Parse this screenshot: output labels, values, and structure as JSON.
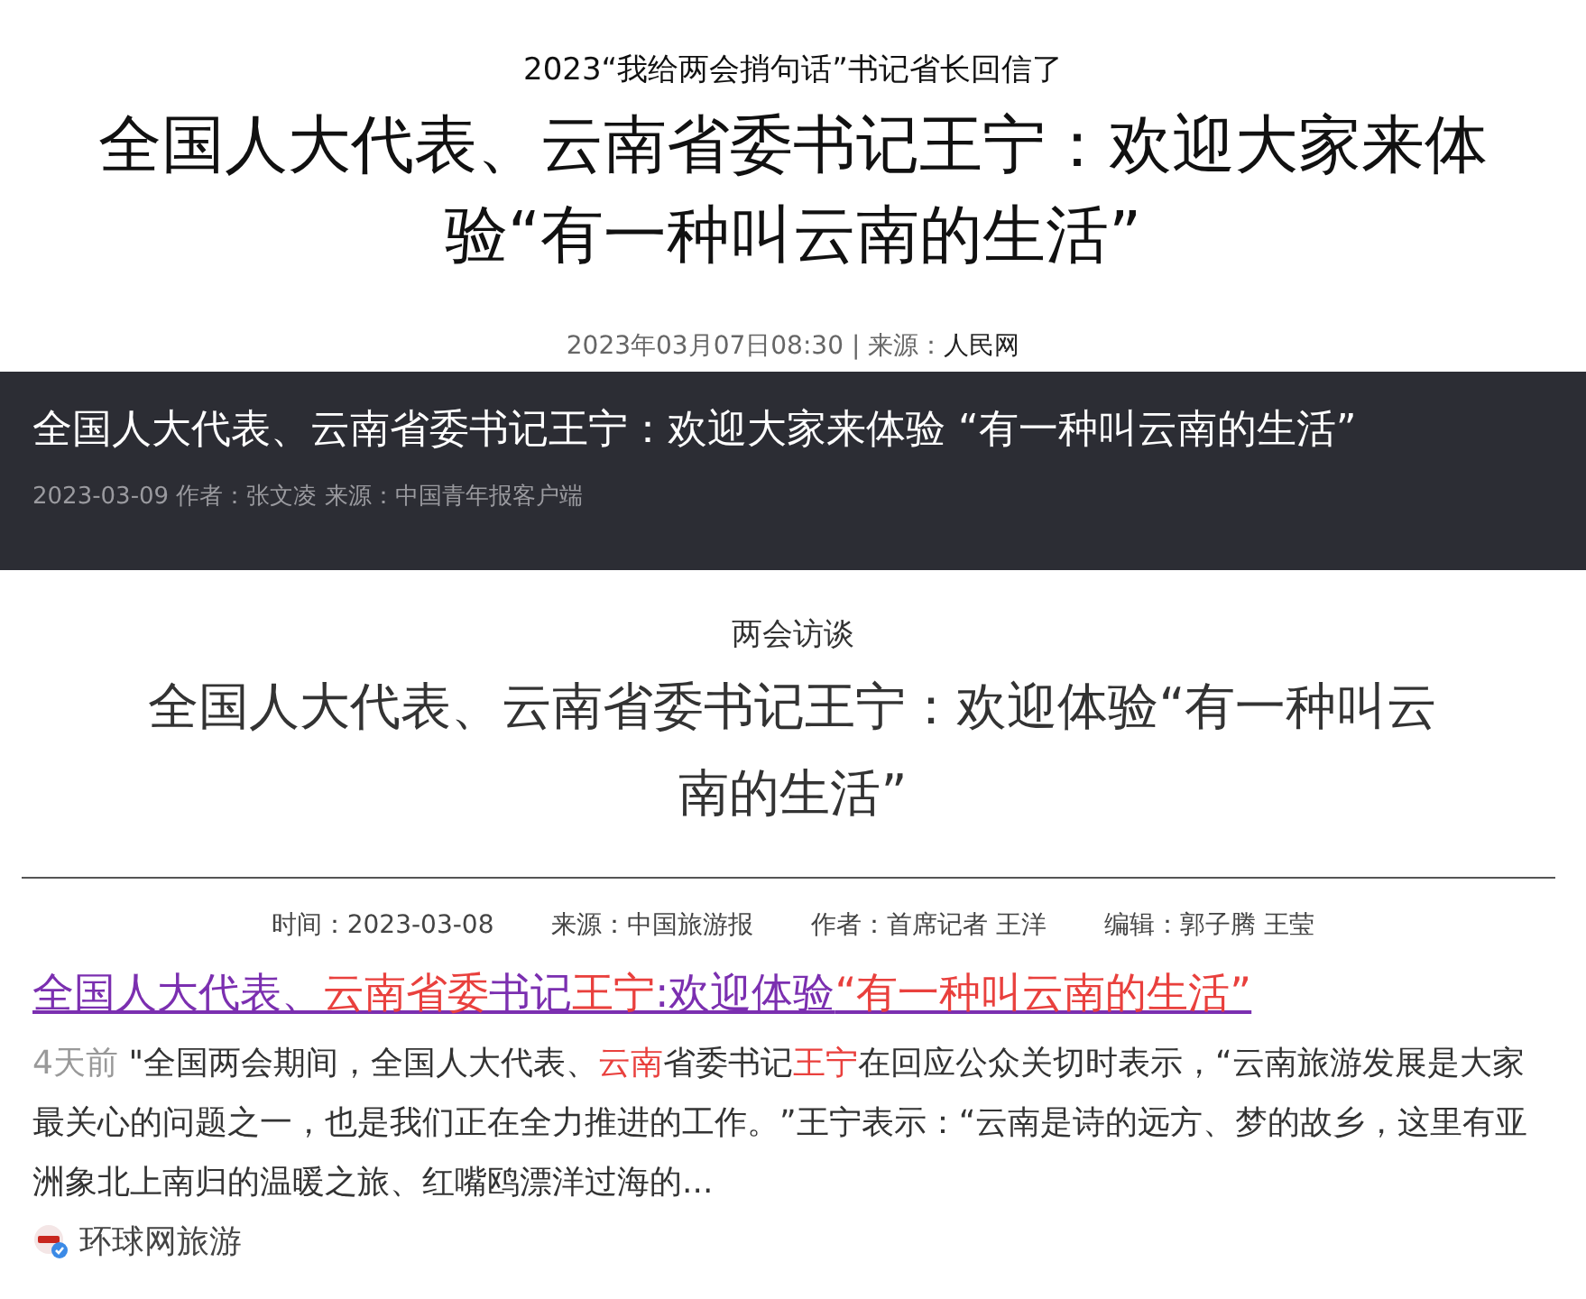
{
  "header_article": {
    "kicker": "2023“我给两会捎句话”书记省长回信了",
    "title": "全国人大代表、云南省委书记王宁：欢迎大家来体验“有一种叫云南的生活”",
    "date": "2023年03月07日08:30",
    "separator": "|",
    "source_label": "来源：",
    "source": "人民网"
  },
  "dark_banner": {
    "title": "全国人大代表、云南省委书记王宁：欢迎大家来体验 “有一种叫云南的生活”",
    "meta": "2023-03-09 作者：张文凌 来源：中国青年报客户端"
  },
  "interview": {
    "category": "两会访谈",
    "title": "全国人大代表、云南省委书记王宁：欢迎体验“有一种叫云南的生活”",
    "meta": [
      "时间：2023-03-08",
      "来源：中国旅游报",
      "作者：首席记者 王洋",
      "编辑：郭子腾 王莹"
    ]
  },
  "search_result": {
    "title_parts": [
      {
        "text": "全国人大代表、",
        "highlight": false
      },
      {
        "text": "云南省委",
        "highlight": true
      },
      {
        "text": "书记",
        "highlight": false
      },
      {
        "text": "王宁",
        "highlight": true
      },
      {
        "text": ":欢迎体验",
        "highlight": false
      },
      {
        "text": "“有一种叫云南的生活”",
        "highlight": true
      }
    ],
    "age": "4天前",
    "snippet_parts": [
      {
        "text": "\"全国两会期间，全国人大代表、",
        "highlight": false
      },
      {
        "text": "云南",
        "highlight": true
      },
      {
        "text": "省委书记",
        "highlight": false
      },
      {
        "text": "王宁",
        "highlight": true
      },
      {
        "text": "在回应公众关切时表示，“云南旅游发展是大家最关心的问题之一，也是我们正在全力推进的工作。”王宁表示：“云南是诗的远方、梦的故乡，这里有亚洲象北上南归的温暖之旅、红嘴鸥漂洋过海的...",
        "highlight": false
      }
    ],
    "publisher": "环球网旅游"
  }
}
